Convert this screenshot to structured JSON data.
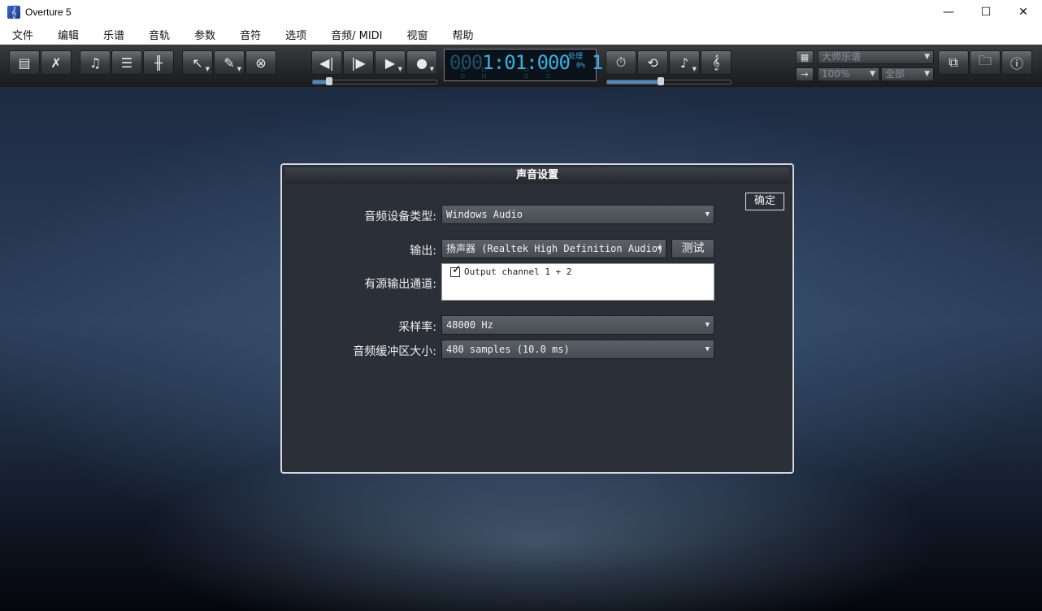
{
  "window": {
    "title": "Overture 5",
    "controls": {
      "minimize": "—",
      "maximize": "☐",
      "close": "✕"
    }
  },
  "menu": [
    "文件",
    "编辑",
    "乐谱",
    "音轨",
    "参数",
    "音符",
    "选项",
    "音频/ MIDI",
    "视窗",
    "帮助"
  ],
  "toolbar": {
    "icons": {
      "score_view": "▤",
      "tools": "✗",
      "note": "♫",
      "list": "☰",
      "mixer": "╫",
      "select": "↖",
      "pencil": "✎",
      "erase": "⊗",
      "rewind": "◀|",
      "step": "|▶",
      "play": "▶",
      "record": "●",
      "metronome": "⏱",
      "loop": "⟲",
      "quant_note": "♪",
      "staff": "𝄞",
      "layout": "▦",
      "arrow_right": "→",
      "copy": "⧉",
      "folder": "🗀",
      "info": "ⓘ"
    },
    "lcd": {
      "bar_dim": "000",
      "position": "1:01:000",
      "beat": "1",
      "side_top": "处理",
      "side_pct": "0%",
      "marks": "□□ □□ □□ □□"
    },
    "score_dropdown": "大师乐谱",
    "zoom_dropdown": "100%",
    "range_dropdown": "全部"
  },
  "dialog": {
    "title": "声音设置",
    "ok_label": "确定",
    "device_type_label": "音频设备类型:",
    "device_type_value": "Windows Audio",
    "output_label": "输出:",
    "output_value": "扬声器 (Realtek High Definition Audio)",
    "test_label": "测试",
    "channels_label": "有源输出通道:",
    "channels": [
      {
        "label": "Output channel 1 + 2",
        "checked": true
      }
    ],
    "sample_rate_label": "采样率:",
    "sample_rate_value": "48000 Hz",
    "buffer_label": "音频缓冲区大小:",
    "buffer_value": "480 samples (10.0 ms)"
  }
}
